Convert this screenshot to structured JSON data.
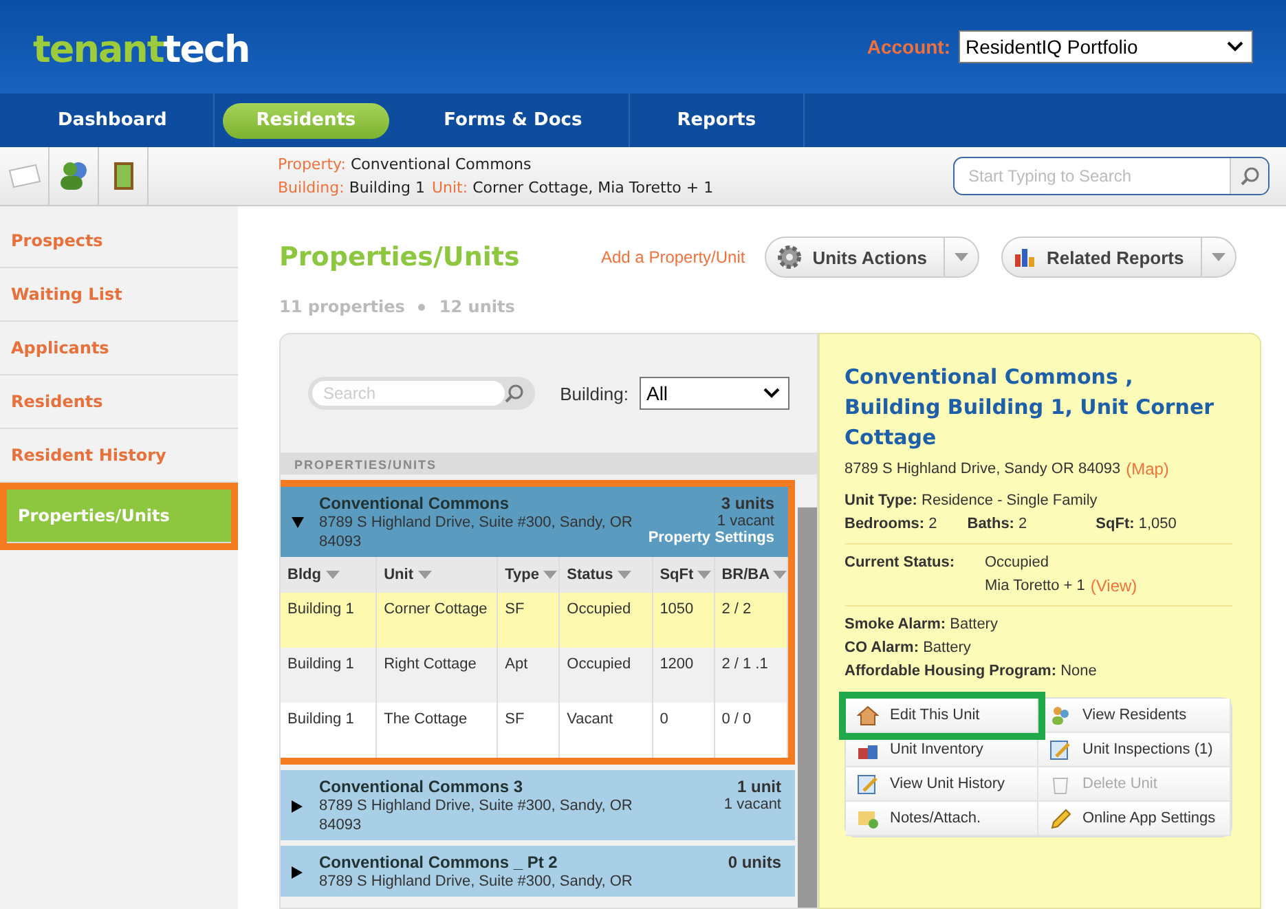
{
  "header": {
    "logo": [
      "tenant",
      "tech"
    ],
    "account_label": "Account:",
    "account_value": "ResidentIQ Portfolio"
  },
  "nav": [
    {
      "label": "Dashboard",
      "selected": false
    },
    {
      "label": "Residents",
      "selected": true
    },
    {
      "label": "Forms & Docs",
      "selected": false
    },
    {
      "label": "Reports",
      "selected": false
    }
  ],
  "context": {
    "property_label": "Property:",
    "property": "Conventional Commons",
    "building_label": "Building:",
    "building": "Building 1",
    "unit_label": "Unit:",
    "unit": "Corner Cottage, Mia Toretto + 1",
    "search_placeholder": "Start Typing to Search"
  },
  "sidebar": [
    {
      "label": "Prospects",
      "selected": false,
      "highlighted": false
    },
    {
      "label": "Waiting List",
      "selected": false,
      "highlighted": false
    },
    {
      "label": "Applicants",
      "selected": false,
      "highlighted": false
    },
    {
      "label": "Residents",
      "selected": false,
      "highlighted": false
    },
    {
      "label": "Resident History",
      "selected": false,
      "highlighted": false
    },
    {
      "label": "Properties/Units",
      "selected": true,
      "highlighted": true
    }
  ],
  "page": {
    "title": "Properties/Units",
    "add_link": "Add a Property/Unit",
    "units_actions": "Units Actions",
    "related_reports": "Related Reports",
    "counts": [
      "11 properties",
      "12 units"
    ]
  },
  "list": {
    "search_placeholder": "Search",
    "building_label": "Building:",
    "building_value": "All",
    "section_label": "PROPERTIES/UNITS",
    "properties": [
      {
        "name": "Conventional Commons",
        "address": "8789 S Highland Drive, Suite #300, Sandy, OR 84093",
        "units": "3 units",
        "vacant": "1 vacant",
        "settings_link": "Property Settings",
        "expanded": true,
        "highlighted": true,
        "columns": [
          "Bldg",
          "Unit",
          "Type",
          "Status",
          "SqFt",
          "BR/BA"
        ],
        "rows": [
          {
            "cells": [
              "Building 1",
              "Corner Cottage",
              "SF",
              "Occupied",
              "1050",
              "2 / 2"
            ],
            "selected": true
          },
          {
            "cells": [
              "Building 1",
              "Right Cottage",
              "Apt",
              "Occupied",
              "1200",
              "2 / 1 .1"
            ],
            "selected": false
          },
          {
            "cells": [
              "Building 1",
              "The Cottage",
              "SF",
              "Vacant",
              "0",
              "0 / 0"
            ],
            "selected": false
          }
        ]
      },
      {
        "name": "Conventional Commons 3",
        "address": "8789 S Highland Drive, Suite #300, Sandy, OR 84093",
        "units": "1 unit",
        "vacant": "1 vacant",
        "expanded": false,
        "highlighted": false
      },
      {
        "name": "Conventional Commons _ Pt 2",
        "address": "8789 S Highland Drive, Suite #300, Sandy, OR",
        "units": "0 units",
        "expanded": false,
        "highlighted": false
      }
    ]
  },
  "detail": {
    "title": "Conventional Commons , Building Building 1, Unit Corner Cottage",
    "address": "8789 S Highland Drive, Sandy OR 84093",
    "map_link": "(Map)",
    "facts": [
      {
        "label": "Unit Type:",
        "value": "Residence - Single Family"
      }
    ],
    "sizes": [
      {
        "label": "Bedrooms:",
        "value": "2"
      },
      {
        "label": "Baths:",
        "value": "2"
      },
      {
        "label": "SqFt:",
        "value": "1,050"
      }
    ],
    "status_label": "Current Status:",
    "status": "Occupied",
    "residents": "Mia Toretto + 1",
    "view_link": "(View)",
    "alarms": [
      {
        "label": "Smoke Alarm:",
        "value": "Battery"
      },
      {
        "label": "CO Alarm:",
        "value": "Battery"
      },
      {
        "label": "Affordable Housing Program:",
        "value": "None"
      }
    ],
    "actions": [
      {
        "label": "Edit This Unit",
        "kind": "house",
        "disabled": false,
        "highlighted": true
      },
      {
        "label": "View Residents",
        "kind": "people",
        "disabled": false,
        "highlighted": false
      },
      {
        "label": "Unit Inventory",
        "kind": "boxes",
        "disabled": false,
        "highlighted": false
      },
      {
        "label": "Unit Inspections (1)",
        "kind": "pencil-doc",
        "disabled": false,
        "highlighted": false
      },
      {
        "label": "View Unit History",
        "kind": "pencil-doc",
        "disabled": false,
        "highlighted": false
      },
      {
        "label": "Delete Unit",
        "kind": "trash",
        "disabled": true,
        "highlighted": false
      },
      {
        "label": "Notes/Attach.",
        "kind": "note",
        "disabled": false,
        "highlighted": false
      },
      {
        "label": "Online App Settings",
        "kind": "pencil",
        "disabled": false,
        "highlighted": false
      }
    ]
  }
}
